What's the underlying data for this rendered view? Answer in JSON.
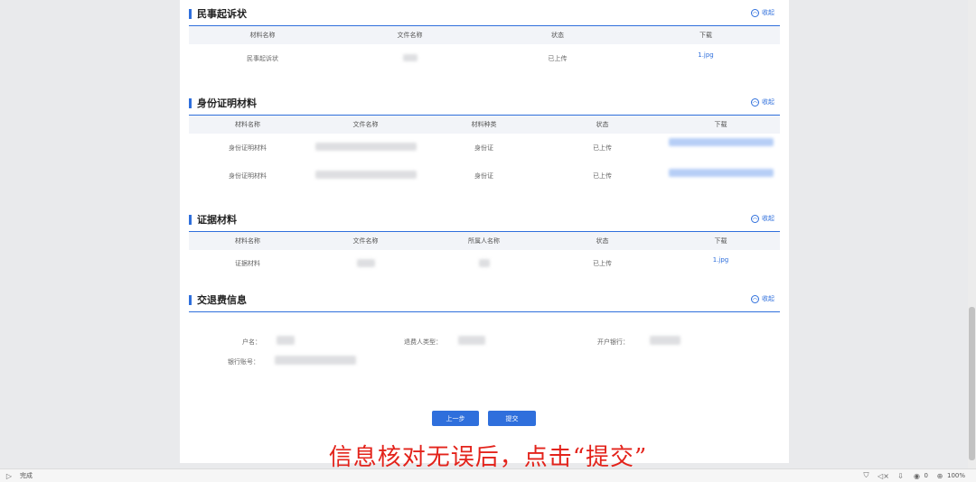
{
  "sections": {
    "complaint": {
      "title": "民事起诉状",
      "collapse": "收起",
      "headers": [
        "材料名称",
        "文件名称",
        "状态",
        "下载"
      ],
      "rows": [
        {
          "material": "民事起诉状",
          "status": "已上传",
          "download": "1.jpg"
        }
      ]
    },
    "identity": {
      "title": "身份证明材料",
      "collapse": "收起",
      "headers": [
        "材料名称",
        "文件名称",
        "材料种类",
        "状态",
        "下载"
      ],
      "rows": [
        {
          "material": "身份证明材料",
          "type": "身份证",
          "status": "已上传"
        },
        {
          "material": "身份证明材料",
          "type": "身份证",
          "status": "已上传"
        }
      ]
    },
    "evidence": {
      "title": "证据材料",
      "collapse": "收起",
      "headers": [
        "材料名称",
        "文件名称",
        "所属人名称",
        "状态",
        "下载"
      ],
      "rows": [
        {
          "material": "证据材料",
          "status": "已上传",
          "download": "1.jpg"
        }
      ]
    },
    "fee": {
      "title": "交退费信息",
      "collapse": "收起",
      "labels": {
        "account_name": "户名：",
        "refund_type": "退费人类型：",
        "bank": "开户银行：",
        "account_no": "银行账号："
      }
    }
  },
  "buttons": {
    "prev": "上一步",
    "submit": "提交"
  },
  "caption": "信息核对无误后，点击“提交”",
  "statusbar": {
    "status": "完成",
    "zoom": "100%",
    "count": "0"
  },
  "colors": {
    "accent": "#2f6fdc",
    "caption": "#e3231b"
  }
}
